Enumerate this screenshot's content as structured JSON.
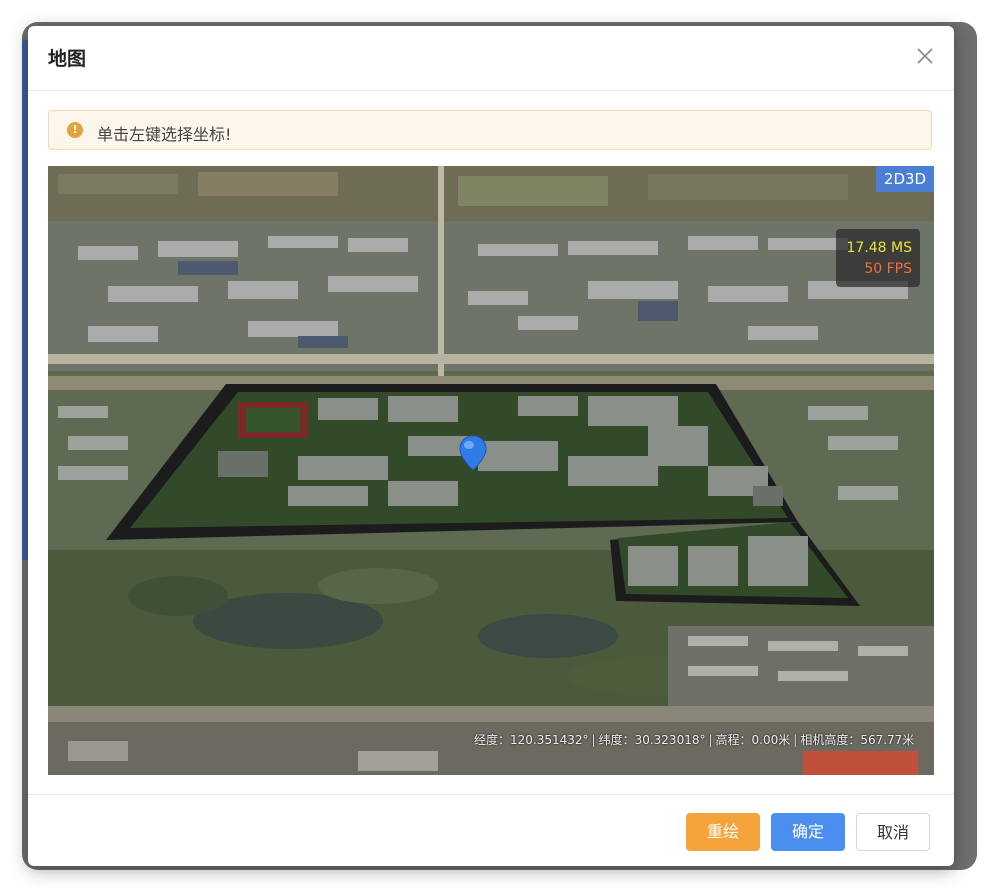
{
  "dialog": {
    "title": "地图",
    "close_icon": "close-icon"
  },
  "alert": {
    "icon": "warning-icon",
    "text": "单击左键选择坐标!"
  },
  "map": {
    "mode_toggle": "2D3D",
    "perf": {
      "ms": "17.48 MS",
      "fps": "50 FPS"
    },
    "marker_icon": "map-pin-icon",
    "status": {
      "longitude": "经度：120.351432°",
      "latitude": "纬度：30.323018°",
      "elevation": "高程：0.00米",
      "camera_height": "相机高度：567.77米",
      "separator": "|"
    }
  },
  "footer": {
    "redraw_label": "重绘",
    "confirm_label": "确定",
    "cancel_label": "取消"
  },
  "colors": {
    "accent": "#4a8ef0",
    "warning": "#f4a43a",
    "alert_bg": "#fdf6ec",
    "perf_ms": "#e8e23a",
    "perf_fps": "#f26d3b"
  }
}
